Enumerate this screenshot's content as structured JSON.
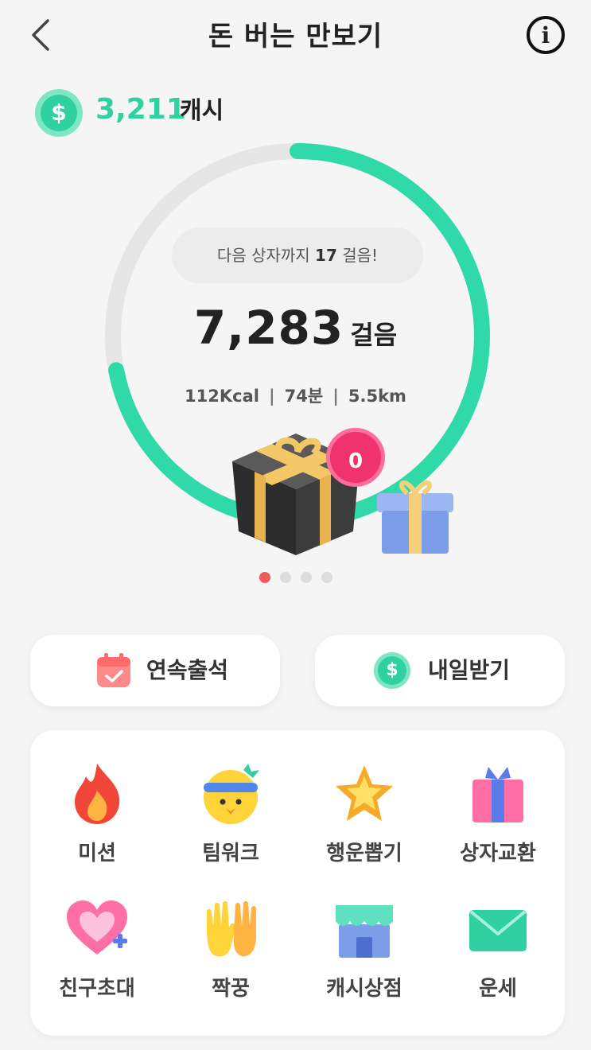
{
  "header": {
    "title": "돈 버는 만보기",
    "back_icon": "chevron-left-icon",
    "info_icon": "info-icon",
    "info_glyph": "i"
  },
  "cash": {
    "symbol": "$",
    "amount": "3,211",
    "unit": "캐시",
    "color": "#2fd1a0"
  },
  "progress": {
    "hint_prefix": "다음 상자까지 ",
    "hint_count": "17",
    "hint_suffix": " 걸음!",
    "steps": "7,283",
    "steps_unit": "걸음",
    "kcal": "112Kcal",
    "minutes": "74분",
    "distance": "5.5km",
    "separator": "|",
    "ring_fraction": 0.72,
    "ring_color": "#2fd9a8"
  },
  "box_badge": "0",
  "carousel": {
    "count": 4,
    "active": 0
  },
  "buttons": {
    "attendance": {
      "label": "연속출석",
      "icon": "calendar-icon"
    },
    "tomorrow": {
      "label": "내일받기",
      "icon": "coin-icon",
      "symbol": "$"
    }
  },
  "menu": [
    {
      "label": "미션",
      "icon": "fire-icon"
    },
    {
      "label": "팀워크",
      "icon": "character-face-icon"
    },
    {
      "label": "행운뽑기",
      "icon": "star-icon"
    },
    {
      "label": "상자교환",
      "icon": "gift-box-icon"
    },
    {
      "label": "친구초대",
      "icon": "heart-plus-icon"
    },
    {
      "label": "짝꿍",
      "icon": "clapping-hands-icon"
    },
    {
      "label": "캐시상점",
      "icon": "store-icon"
    },
    {
      "label": "운세",
      "icon": "envelope-icon"
    }
  ]
}
